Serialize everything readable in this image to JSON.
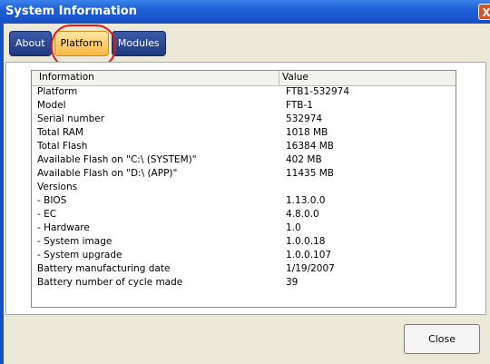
{
  "window": {
    "title": "System Information",
    "close_glyph": "X"
  },
  "tabs": [
    {
      "label": "About",
      "active": false
    },
    {
      "label": "Platform",
      "active": true
    },
    {
      "label": "Modules",
      "active": false
    }
  ],
  "table": {
    "headers": {
      "information": "Information",
      "value": "Value"
    },
    "rows": [
      {
        "info": "Platform",
        "value": "FTB1-532974"
      },
      {
        "info": "Model",
        "value": "FTB-1"
      },
      {
        "info": "Serial number",
        "value": "532974"
      },
      {
        "info": "Total RAM",
        "value": "1018 MB"
      },
      {
        "info": "Total Flash",
        "value": "16384 MB"
      },
      {
        "info": "Available Flash on \"C:\\ (SYSTEM)\"",
        "value": "402 MB"
      },
      {
        "info": "Available Flash on \"D:\\ (APP)\"",
        "value": "11435 MB"
      },
      {
        "info": "Versions",
        "value": ""
      },
      {
        "info": "- BIOS",
        "value": "1.13.0.0"
      },
      {
        "info": "- EC",
        "value": "4.8.0.0"
      },
      {
        "info": "- Hardware",
        "value": "1.0"
      },
      {
        "info": "- System image",
        "value": "1.0.0.18"
      },
      {
        "info": "- System upgrade",
        "value": "1.0.0.107"
      },
      {
        "info": "Battery manufacturing date",
        "value": "1/19/2007"
      },
      {
        "info": "Battery number of cycle made",
        "value": "39"
      }
    ]
  },
  "footer": {
    "close_label": "Close"
  },
  "colors": {
    "titlebar": "#1f5fd6",
    "active_tab": "#f9b73f",
    "highlight": "#e1161b"
  }
}
